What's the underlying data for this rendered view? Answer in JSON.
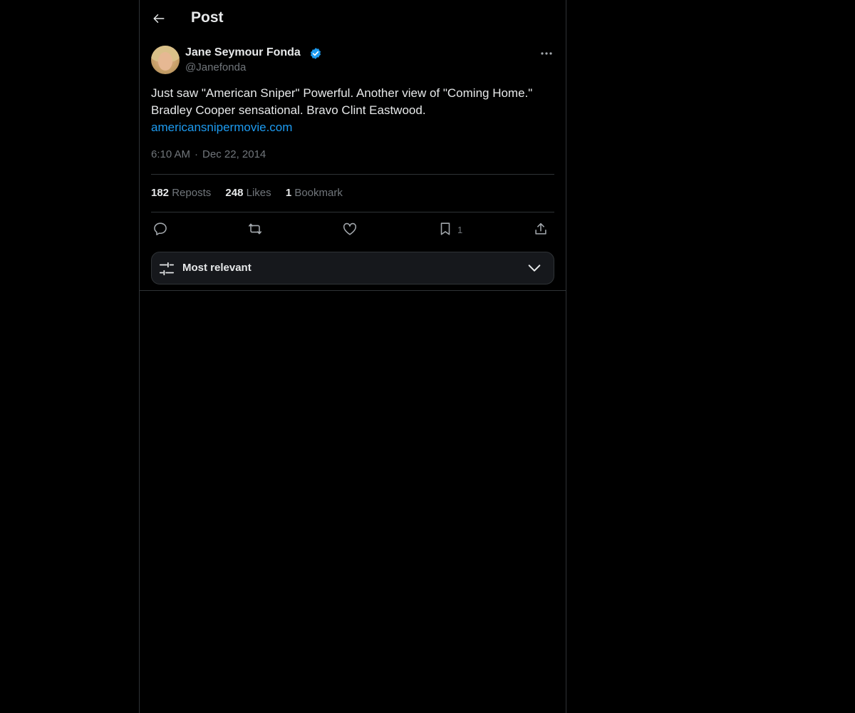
{
  "header": {
    "back_icon": "arrow-left-icon",
    "title": "Post"
  },
  "author": {
    "name": "Jane Seymour Fonda",
    "handle": "@Janefonda",
    "verified": true,
    "verified_color": "#1d9bf0",
    "avatar_icon": "profile-photo"
  },
  "tweet": {
    "text": "Just saw \"American Sniper\" Powerful. Another view of \"Coming Home.\" Bradley Cooper sensational. Bravo Clint Eastwood.",
    "link": "americansnipermovie.com",
    "link_color": "#1d9bf0",
    "time": "6:10 AM",
    "separator": "·",
    "date": "Dec 22, 2014"
  },
  "stats": {
    "reposts_count": "182",
    "reposts_label": "Reposts",
    "likes_count": "248",
    "likes_label": "Likes",
    "bookmarks_count": "1",
    "bookmarks_label": "Bookmark"
  },
  "actions": {
    "reply_icon": "reply-icon",
    "repost_icon": "repost-icon",
    "like_icon": "heart-icon",
    "bookmark_icon": "bookmark-icon",
    "bookmark_count": "1",
    "share_icon": "share-icon"
  },
  "sort": {
    "label": "Most relevant",
    "icon": "sliders-icon",
    "chevron": "chevron-down-icon"
  },
  "colors": {
    "background": "#000000",
    "text": "#e7e9ea",
    "secondary_text": "#71767b",
    "border": "#2f3336",
    "accent": "#1d9bf0"
  }
}
